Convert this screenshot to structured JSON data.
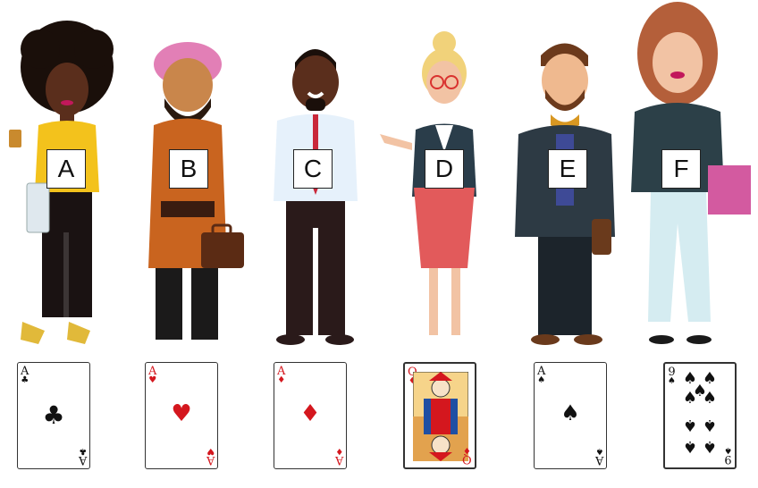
{
  "people": [
    {
      "label": "A",
      "card": {
        "rank": "A",
        "suit": "♣",
        "color": "black"
      }
    },
    {
      "label": "B",
      "card": {
        "rank": "A",
        "suit": "♥",
        "color": "red"
      }
    },
    {
      "label": "C",
      "card": {
        "rank": "A",
        "suit": "♦",
        "color": "red"
      }
    },
    {
      "label": "D",
      "card": {
        "rank": "Q",
        "suit": "♦",
        "color": "red"
      }
    },
    {
      "label": "E",
      "card": {
        "rank": "A",
        "suit": "♠",
        "color": "black"
      }
    },
    {
      "label": "F",
      "card": {
        "rank": "9",
        "suit": "♠",
        "color": "black"
      }
    }
  ],
  "colors": {
    "red_suit": "#d4171e",
    "black_suit": "#111111"
  }
}
